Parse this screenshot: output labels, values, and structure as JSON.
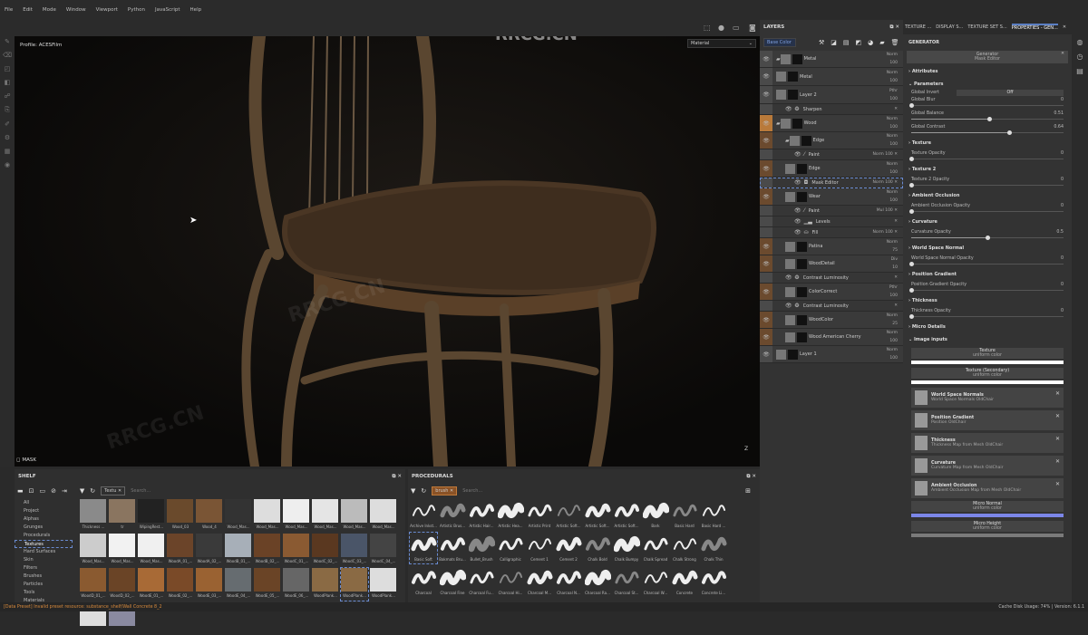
{
  "menu": [
    "File",
    "Edit",
    "Mode",
    "Window",
    "Viewport",
    "Python",
    "JavaScript",
    "Help"
  ],
  "watermark": "RRCG.CN",
  "viewport": {
    "profile": "Profile: ACESFilm",
    "material_select": "Material",
    "mask_label": "MASK",
    "axis_label": "Z"
  },
  "layers": {
    "title": "LAYERS",
    "view_select": "Base Color",
    "rows": [
      {
        "type": "folder",
        "name": "Metal",
        "blend": "Norm",
        "opacity": "100",
        "indent": 0,
        "strip": "gray"
      },
      {
        "type": "layer",
        "name": "Metal",
        "blend": "Norm",
        "opacity": "100",
        "indent": 0,
        "strip": "gray"
      },
      {
        "type": "layer",
        "name": "Layer 2",
        "blend": "Pthr",
        "opacity": "100",
        "indent": 0,
        "strip": "none"
      },
      {
        "type": "effect",
        "name": "Sharpen",
        "indent": 1,
        "icon": "filter"
      },
      {
        "type": "folder",
        "name": "Wood",
        "blend": "Norm",
        "opacity": "100",
        "indent": 0,
        "strip": "orange"
      },
      {
        "type": "folder",
        "name": "Edge",
        "blend": "Norm",
        "opacity": "100",
        "indent": 1,
        "strip": "wood"
      },
      {
        "type": "effect",
        "name": "Paint",
        "blend": "Norm",
        "opacity": "100",
        "indent": 2,
        "icon": "brush"
      },
      {
        "type": "layer",
        "name": "Edge",
        "blend": "Norm",
        "opacity": "100",
        "indent": 1,
        "strip": "wood"
      },
      {
        "type": "effect",
        "name": "Mask Editor",
        "blend": "Norm",
        "opacity": "100",
        "indent": 2,
        "icon": "generator",
        "selected": true
      },
      {
        "type": "layer",
        "name": "Wear",
        "blend": "Norm",
        "opacity": "100",
        "indent": 1,
        "strip": "wood"
      },
      {
        "type": "effect",
        "name": "Paint",
        "blend": "Mul",
        "opacity": "100",
        "indent": 2,
        "icon": "brush"
      },
      {
        "type": "effect",
        "name": "Levels",
        "indent": 2,
        "icon": "levels"
      },
      {
        "type": "effect",
        "name": "Fill",
        "blend": "Norm",
        "opacity": "100",
        "indent": 2,
        "icon": "fill"
      },
      {
        "type": "layer",
        "name": "Patina",
        "blend": "Norm",
        "opacity": "75",
        "indent": 1,
        "strip": "wood"
      },
      {
        "type": "layer",
        "name": "WoodDetail",
        "blend": "Div",
        "opacity": "10",
        "indent": 1,
        "strip": "wood"
      },
      {
        "type": "effect",
        "name": "Contrast Luminosity",
        "indent": 1,
        "icon": "filter"
      },
      {
        "type": "layer",
        "name": "ColorCorrect",
        "blend": "Pthr",
        "opacity": "100",
        "indent": 1,
        "strip": "wood"
      },
      {
        "type": "effect",
        "name": "Contrast Luminosity",
        "indent": 1,
        "icon": "filter"
      },
      {
        "type": "layer",
        "name": "WoodColor",
        "blend": "Norm",
        "opacity": "25",
        "indent": 1,
        "strip": "wood"
      },
      {
        "type": "layer",
        "name": "Wood American Cherry",
        "blend": "Norm",
        "opacity": "100",
        "indent": 1,
        "strip": "wood"
      },
      {
        "type": "layer",
        "name": "Layer 1",
        "blend": "Norm",
        "opacity": "100",
        "indent": 0,
        "strip": "none"
      }
    ]
  },
  "properties": {
    "tabs": [
      "TEXTURE ...",
      "DISPLAY S...",
      "TEXTURE SET S...",
      "PROPERTIES - GEN..."
    ],
    "section_title": "GENERATOR",
    "generator": {
      "name": "Generator",
      "value": "Mask Editor"
    },
    "attributes": "Attributes",
    "parameters": "Parameters",
    "global_invert": {
      "label": "Global Invert",
      "value": "Off"
    },
    "sliders": [
      {
        "label": "Global Blur",
        "value": 0
      },
      {
        "label": "Global Balance",
        "value": 0.51
      },
      {
        "label": "Global Contrast",
        "value": 0.64
      },
      {
        "group": "Texture",
        "label": "Texture Opacity",
        "value": 0
      },
      {
        "group": "Texture 2",
        "label": "Texture 2 Opacity",
        "value": 0
      },
      {
        "group": "Ambient Occlusion",
        "label": "Ambient Occlusion Opacity",
        "value": 0
      },
      {
        "group": "Curvature",
        "label": "Curvature Opacity",
        "value": 0.5
      },
      {
        "group": "World Space Normal",
        "label": "World Space Normal Opacity",
        "value": 0
      },
      {
        "group": "Position Gradient",
        "label": "Position Gradient Opacity",
        "value": 0
      },
      {
        "group": "Thickness",
        "label": "Thickness Opacity",
        "value": 0
      }
    ],
    "micro_details": "Micro Details",
    "image_inputs_title": "Image inputs",
    "color_inputs": [
      {
        "name": "Texture",
        "sub": "uniform color",
        "color": "#ffffff"
      },
      {
        "name": "Texture (Secondary)",
        "sub": "uniform color",
        "color": "#ffffff"
      }
    ],
    "map_inputs": [
      {
        "name": "World Space Normals",
        "sub": "World Space Normals OldChair"
      },
      {
        "name": "Position Gradient",
        "sub": "Position OldChair"
      },
      {
        "name": "Thickness",
        "sub": "Thickness Map from Mesh OldChair"
      },
      {
        "name": "Curvature",
        "sub": "Curvature Map from Mesh OldChair"
      },
      {
        "name": "Ambient Occlusion",
        "sub": "Ambient Occlusion Map from Mesh OldChair"
      }
    ],
    "color_inputs2": [
      {
        "name": "Micro Normal",
        "sub": "uniform color",
        "color": "#7b86e8"
      },
      {
        "name": "Micro Height",
        "sub": "uniform color",
        "color": "#7a7a7a"
      }
    ]
  },
  "shelf": {
    "title": "SHELF",
    "filter_chip": "Textu",
    "search_placeholder": "Search...",
    "categories": [
      "All",
      "Project",
      "Alphas",
      "Grunges",
      "Procedurals",
      "Textures",
      "Hard Surfaces",
      "Skin",
      "Filters",
      "Brushes",
      "Particles",
      "Tools",
      "Materials"
    ],
    "active_category": "Textures",
    "items": [
      {
        "name": "Thickness ...",
        "c": "#8a8a8a"
      },
      {
        "name": "tr",
        "c": "#8a7560"
      },
      {
        "name": "WipingRest...",
        "c": "#222"
      },
      {
        "name": "Wood_03",
        "c": "#6a4a2c"
      },
      {
        "name": "Wood_4",
        "c": "#7a5535"
      },
      {
        "name": "Wood_Mas...",
        "c": "#333"
      },
      {
        "name": "Wood_Mas...",
        "c": "#ddd"
      },
      {
        "name": "Wood_Mas...",
        "c": "#eee"
      },
      {
        "name": "Wood_Mas...",
        "c": "#e5e5e5"
      },
      {
        "name": "Wood_Mas...",
        "c": "#bbb"
      },
      {
        "name": "Wood_Mas...",
        "c": "#ddd"
      },
      {
        "name": "Wood_Mas...",
        "c": "#ccc"
      },
      {
        "name": "Wood_Mas...",
        "c": "#f2f2f2"
      },
      {
        "name": "Wood_Mas...",
        "c": "#f0f0f0"
      },
      {
        "name": "WoodA_01_...",
        "c": "#6b4429"
      },
      {
        "name": "WoodA_02_...",
        "c": "#3a3a3a"
      },
      {
        "name": "WoodB_01_...",
        "c": "#a7afb8"
      },
      {
        "name": "WoodB_02_...",
        "c": "#6a4226"
      },
      {
        "name": "WoodC_01_...",
        "c": "#8a5a32"
      },
      {
        "name": "WoodC_02_...",
        "c": "#5a3820"
      },
      {
        "name": "WoodC_03_...",
        "c": "#4a5568"
      },
      {
        "name": "WoodC_04_...",
        "c": "#444"
      },
      {
        "name": "WoodD_01_...",
        "c": "#8a5a30"
      },
      {
        "name": "WoodD_02_...",
        "c": "#6a4426"
      },
      {
        "name": "WoodE_01_...",
        "c": "#a86a36"
      },
      {
        "name": "WoodE_02_...",
        "c": "#7a4a28"
      },
      {
        "name": "WoodE_03_...",
        "c": "#9a6232"
      },
      {
        "name": "WoodE_04_...",
        "c": "#666c70"
      },
      {
        "name": "WoodE_05_...",
        "c": "#6a4426"
      },
      {
        "name": "WoodE_06_...",
        "c": "#666"
      },
      {
        "name": "WoodPlank...",
        "c": "#8a6a44"
      },
      {
        "name": "WoodPlank...",
        "c": "#8a6a44",
        "selected": true
      },
      {
        "name": "WoodPlank...",
        "c": "#ddd"
      },
      {
        "name": "",
        "c": "#ddd"
      },
      {
        "name": "",
        "c": "#8a8aa0"
      }
    ]
  },
  "procedurals": {
    "title": "PROCEDURALS",
    "filter_chip": "brush",
    "search_placeholder": "Search...",
    "items": [
      "Archive Inkst...",
      "Artistic Brus...",
      "Artistic Hair...",
      "Artistic Hea...",
      "Artistic Print",
      "Artistic Soft...",
      "Artistic Soft...",
      "Artistic Soft...",
      "Bark",
      "Basic Hard",
      "Basic Hard ...",
      "Basic Soft",
      "Bakmats Bru...",
      "Bullet_Brush",
      "Calligraphic",
      "Cement 1",
      "Cement 2",
      "Chalk Bold",
      "Chalk Bumpy",
      "Chalk Spread",
      "Chalk Strong",
      "Chalk Thin",
      "Charcoal",
      "Charcoal Fine",
      "Charcoal Fu...",
      "Charcoal Hi...",
      "Charcoal M...",
      "Charcoal N...",
      "Charcoal Ra...",
      "Charcoal St...",
      "Charcoal W...",
      "Concrete",
      "Concrete Li..."
    ],
    "selected": "Basic Soft"
  },
  "status": {
    "error": "[Data Preset] Invalid preset resource: substance_shelf/Wall Concrete 8_2",
    "right": "Cache Disk Usage: 74% | Version: 6.1.1"
  }
}
